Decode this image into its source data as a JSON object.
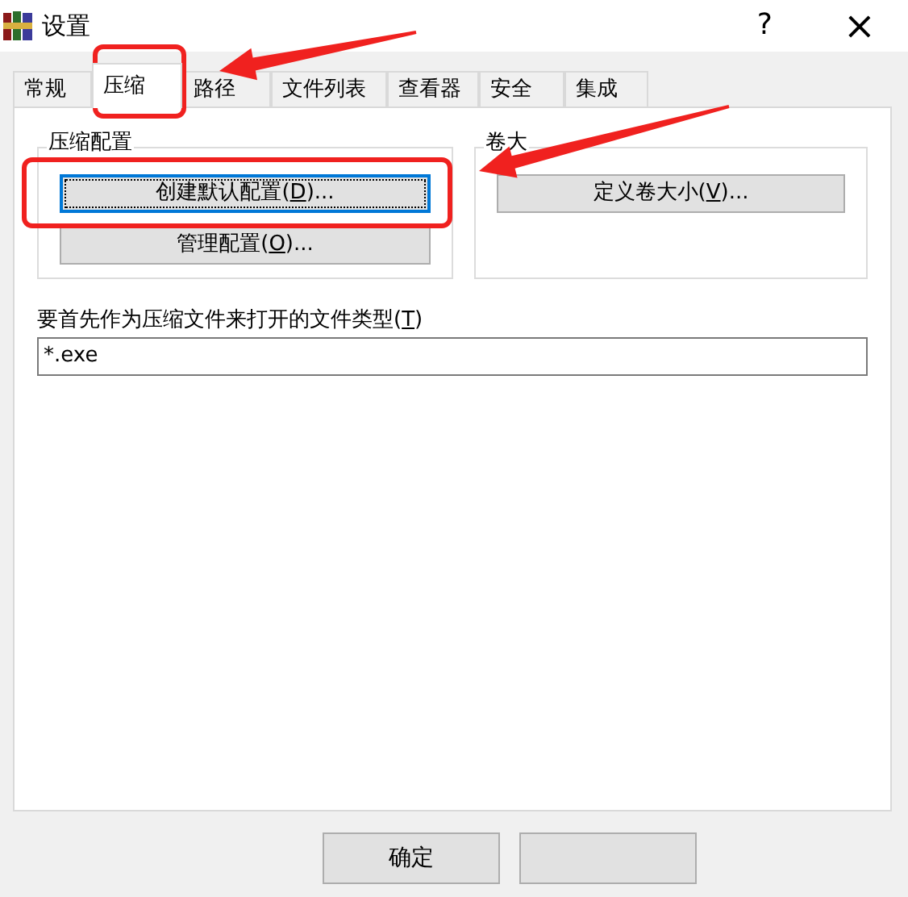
{
  "window": {
    "title": "设置",
    "help": "?",
    "close": "×"
  },
  "tabs": [
    {
      "label": "常规",
      "selected": false
    },
    {
      "label": "压缩",
      "selected": true
    },
    {
      "label": "路径",
      "selected": false
    },
    {
      "label": "文件列表",
      "selected": false
    },
    {
      "label": "查看器",
      "selected": false
    },
    {
      "label": "安全",
      "selected": false
    },
    {
      "label": "集成",
      "selected": false
    }
  ],
  "groups": [
    {
      "title": "压缩配置",
      "buttons": [
        {
          "before": "创建默认配置(",
          "key": "D",
          "after": ")...",
          "focused": true
        },
        {
          "before": "管理配置(",
          "key": "O",
          "after": ")...",
          "focused": false
        }
      ]
    },
    {
      "title": "卷大",
      "buttons": [
        {
          "before": "定义卷大小(",
          "key": "V",
          "after": ")...",
          "focused": false
        }
      ]
    }
  ],
  "file_types": {
    "before": "要首先作为压缩文件来打开的文件类型(",
    "key": "T",
    "after": ")",
    "value": "*.exe"
  },
  "footer_buttons": [
    {
      "kind": "text",
      "label": "确定"
    },
    {
      "kind": "blank"
    }
  ]
}
